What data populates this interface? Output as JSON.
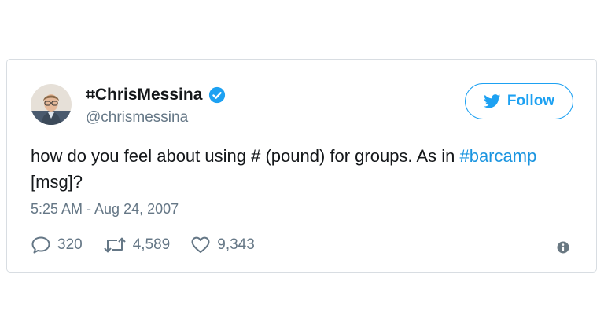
{
  "user": {
    "name_symbol": "⌗",
    "name": "ChrisMessina",
    "handle": "@chrismessina"
  },
  "follow_button": {
    "label": "Follow"
  },
  "tweet": {
    "text_before": "how do you feel about using # (pound) for groups. As in ",
    "hashtag": "#barcamp",
    "text_after": " [msg]?",
    "timestamp": "5:25 AM - Aug 24, 2007"
  },
  "actions": {
    "replies": "320",
    "retweets": "4,589",
    "likes": "9,343"
  },
  "colors": {
    "accent": "#1da1f2",
    "link": "#1b95e0",
    "muted": "#657786"
  },
  "icons": [
    "verified-icon",
    "twitter-bird-icon",
    "reply-icon",
    "retweet-icon",
    "like-icon",
    "info-icon"
  ]
}
